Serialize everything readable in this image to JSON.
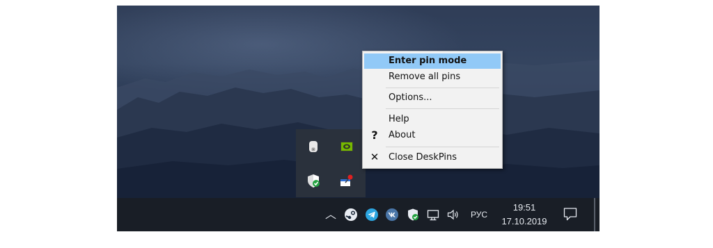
{
  "context_menu": {
    "items": [
      {
        "label": "Enter pin mode",
        "bold": true,
        "highlighted": true
      },
      {
        "label": "Remove all pins"
      },
      {
        "label": "Options..."
      },
      {
        "label": "Help"
      },
      {
        "label": "About",
        "icon": "question-mark-icon"
      },
      {
        "label": "Close DeskPins",
        "icon": "close-x-icon"
      }
    ],
    "about_glyph": "?",
    "close_glyph": "✕"
  },
  "overflow_tray": {
    "icons": [
      "eject-device-icon",
      "nvidia-icon",
      "windows-security-icon",
      "deskpins-icon"
    ]
  },
  "taskbar": {
    "tray_chevron": "︿",
    "tray_icons": [
      "steam-icon",
      "telegram-icon",
      "vk-icon",
      "defender-icon",
      "network-icon",
      "volume-icon"
    ],
    "language": "РУС",
    "time": "19:51",
    "date": "17.10.2019",
    "notification_icon": "action-center-icon"
  },
  "colors": {
    "menu_highlight": "#91c9f7",
    "taskbar": "#191e26",
    "overflow_bg": "#2a313c"
  }
}
